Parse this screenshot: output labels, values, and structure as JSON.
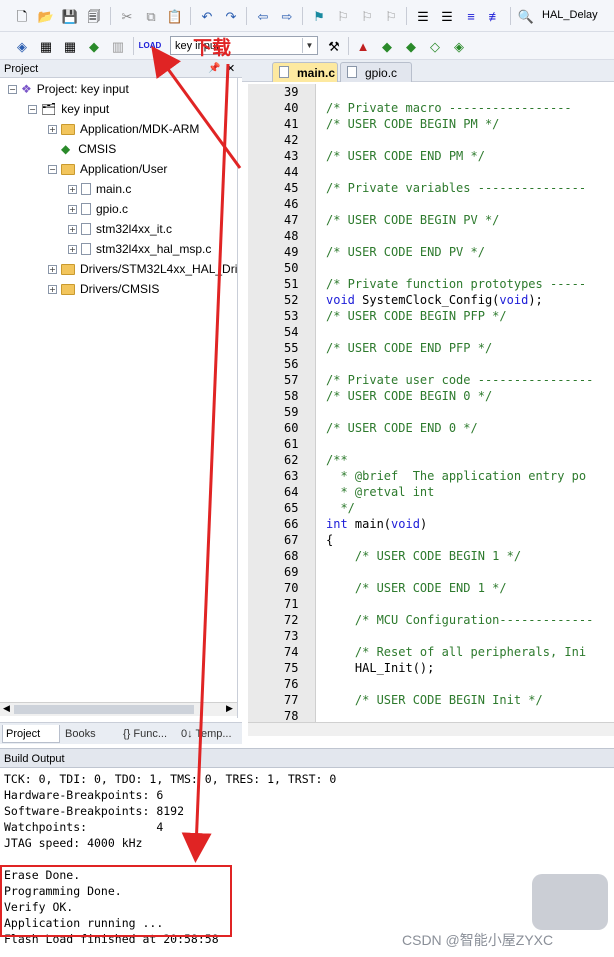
{
  "toolbar": {
    "target_name": "HAL_Delay",
    "target_combo": "key input"
  },
  "annotation": {
    "download_label": "下载"
  },
  "project_panel": {
    "title": "Project",
    "tree": [
      {
        "label": "Project: key input",
        "exp": "−"
      },
      {
        "label": "key input",
        "exp": "−"
      },
      {
        "label": "Application/MDK-ARM",
        "exp": "+"
      },
      {
        "label": "CMSIS",
        "exp": ""
      },
      {
        "label": "Application/User",
        "exp": "−"
      },
      {
        "label": "main.c",
        "exp": "+"
      },
      {
        "label": "gpio.c",
        "exp": "+"
      },
      {
        "label": "stm32l4xx_it.c",
        "exp": "+"
      },
      {
        "label": "stm32l4xx_hal_msp.c",
        "exp": "+"
      },
      {
        "label": "Drivers/STM32L4xx_HAL_Driv",
        "exp": "+"
      },
      {
        "label": "Drivers/CMSIS",
        "exp": "+"
      }
    ],
    "bottom_tabs": [
      "Project",
      "Books",
      "{} Func...",
      "0↓ Temp..."
    ]
  },
  "editor": {
    "tabs": [
      "main.c",
      "gpio.c"
    ],
    "lines": [
      {
        "n": "39",
        "t": "",
        "cls": ""
      },
      {
        "n": "40",
        "t": "/* Private macro -----------------",
        "cls": "c"
      },
      {
        "n": "41",
        "t": "/* USER CODE BEGIN PM */",
        "cls": "c"
      },
      {
        "n": "42",
        "t": "",
        "cls": ""
      },
      {
        "n": "43",
        "t": "/* USER CODE END PM */",
        "cls": "c"
      },
      {
        "n": "44",
        "t": "",
        "cls": ""
      },
      {
        "n": "45",
        "t": "/* Private variables ---------------",
        "cls": "c"
      },
      {
        "n": "46",
        "t": "",
        "cls": ""
      },
      {
        "n": "47",
        "t": "/* USER CODE BEGIN PV */",
        "cls": "c"
      },
      {
        "n": "48",
        "t": "",
        "cls": ""
      },
      {
        "n": "49",
        "t": "/* USER CODE END PV */",
        "cls": "c"
      },
      {
        "n": "50",
        "t": "",
        "cls": ""
      },
      {
        "n": "51",
        "t": "/* Private function prototypes -----",
        "cls": "c"
      },
      {
        "n": "52",
        "t": "void SystemClock_Config(void);",
        "cls": "mix"
      },
      {
        "n": "53",
        "t": "/* USER CODE BEGIN PFP */",
        "cls": "c"
      },
      {
        "n": "54",
        "t": "",
        "cls": ""
      },
      {
        "n": "55",
        "t": "/* USER CODE END PFP */",
        "cls": "c"
      },
      {
        "n": "56",
        "t": "",
        "cls": ""
      },
      {
        "n": "57",
        "t": "/* Private user code ----------------",
        "cls": "c"
      },
      {
        "n": "58",
        "t": "/* USER CODE BEGIN 0 */",
        "cls": "c"
      },
      {
        "n": "59",
        "t": "",
        "cls": ""
      },
      {
        "n": "60",
        "t": "/* USER CODE END 0 */",
        "cls": "c"
      },
      {
        "n": "61",
        "t": "",
        "cls": ""
      },
      {
        "n": "62",
        "t": "/**",
        "cls": "c"
      },
      {
        "n": "63",
        "t": "  * @brief  The application entry po",
        "cls": "c"
      },
      {
        "n": "64",
        "t": "  * @retval int",
        "cls": "c"
      },
      {
        "n": "65",
        "t": "  */",
        "cls": "c"
      },
      {
        "n": "66",
        "t": "int main(void)",
        "cls": "mix"
      },
      {
        "n": "67",
        "t": "{",
        "cls": ""
      },
      {
        "n": "68",
        "t": "    /* USER CODE BEGIN 1 */",
        "cls": "c"
      },
      {
        "n": "69",
        "t": "",
        "cls": ""
      },
      {
        "n": "70",
        "t": "    /* USER CODE END 1 */",
        "cls": "c"
      },
      {
        "n": "71",
        "t": "",
        "cls": ""
      },
      {
        "n": "72",
        "t": "    /* MCU Configuration-------------",
        "cls": "c"
      },
      {
        "n": "73",
        "t": "",
        "cls": ""
      },
      {
        "n": "74",
        "t": "    /* Reset of all peripherals, Ini",
        "cls": "c"
      },
      {
        "n": "75",
        "t": "    HAL_Init();",
        "cls": ""
      },
      {
        "n": "76",
        "t": "",
        "cls": ""
      },
      {
        "n": "77",
        "t": "    /* USER CODE BEGIN Init */",
        "cls": "c"
      },
      {
        "n": "78",
        "t": "",
        "cls": ""
      }
    ]
  },
  "build_output": {
    "title": "Build Output",
    "lines": [
      "TCK: 0, TDI: 0, TDO: 1, TMS: 0, TRES: 1, TRST: 0",
      "Hardware-Breakpoints: 6",
      "Software-Breakpoints: 8192",
      "Watchpoints:          4",
      "JTAG speed: 4000 kHz",
      "",
      "Erase Done.",
      "Programming Done.",
      "Verify OK.",
      "Application running ...",
      "Flash Load finished at 20:58:58"
    ]
  },
  "watermark": "CSDN @智能小屋ZYXC",
  "colors": {
    "annotation_red": "#e02424",
    "comment_green": "#2d7a2d",
    "keyword_blue": "#1c1cd8"
  }
}
